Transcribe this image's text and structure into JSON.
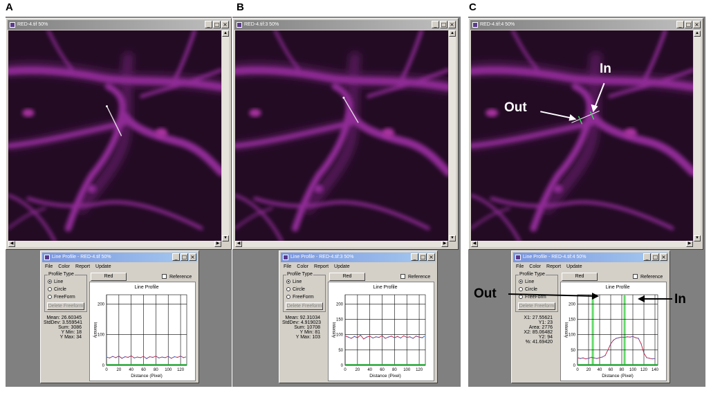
{
  "panels": [
    {
      "letter": "A",
      "image_title": "RED-4.tif 50%",
      "profile_title": "Line Profile - RED-4.tif 50%",
      "menu": [
        "File",
        "Color",
        "Report",
        "Update"
      ],
      "profile_type_label": "Profile Type",
      "options": [
        "Line",
        "Circle",
        "FreeForm"
      ],
      "selected_option": "Line",
      "delete_label": "Delete Freeform",
      "color_button": "Red",
      "reference_label": "Reference",
      "stats": [
        "Mean: 26.60345",
        "StdDev: 3.559541",
        "Sum: 3086",
        "Y Min: 18",
        "Y Max: 34"
      ]
    },
    {
      "letter": "B",
      "image_title": "RED-4.tif:3 50%",
      "profile_title": "Line Profile - RED-4.tif:3 50%",
      "menu": [
        "File",
        "Color",
        "Report",
        "Update"
      ],
      "profile_type_label": "Profile Type",
      "options": [
        "Line",
        "Circle",
        "FreeForm"
      ],
      "selected_option": "Line",
      "delete_label": "Delete Freeform",
      "color_button": "Red",
      "reference_label": "Reference",
      "stats": [
        "Mean: 92.31034",
        "StdDev: 4.919023",
        "Sum: 10708",
        "Y Min: 81",
        "Y Max: 103"
      ]
    },
    {
      "letter": "C",
      "image_title": "RED-4.tif:4 50%",
      "profile_title": "Line Profile - RED-4.tif:4 50%",
      "menu": [
        "File",
        "Color",
        "Report",
        "Update"
      ],
      "profile_type_label": "Profile Type",
      "options": [
        "Line",
        "Circle",
        "FreeForm"
      ],
      "selected_option": "Line",
      "delete_label": "Delete Freeform",
      "color_button": "Red",
      "reference_label": "Reference",
      "stats": [
        "X1: 27.55621",
        "Y1: 23",
        "Area: 2776",
        "X2: 85.06482",
        "Y2: 94",
        "%: 41.69420"
      ],
      "image_annotations": {
        "in": "In",
        "out": "Out"
      },
      "chart_annotations": {
        "in": "In",
        "out": "Out"
      }
    }
  ],
  "chart_data": [
    {
      "type": "line",
      "title": "Line Profile",
      "xlabel": "Distance (Pixel)",
      "ylabel": "Intensity",
      "xticks": [
        0,
        20,
        40,
        60,
        80,
        100,
        120
      ],
      "yticks": [
        0,
        100,
        200
      ],
      "xlim": [
        0,
        130
      ],
      "ylim": [
        0,
        230
      ],
      "series": [
        {
          "x": [
            0,
            5,
            10,
            15,
            20,
            25,
            30,
            35,
            40,
            45,
            50,
            55,
            60,
            65,
            70,
            75,
            80,
            85,
            90,
            95,
            100,
            105,
            110,
            115,
            120,
            125,
            128
          ],
          "y": [
            27,
            24,
            29,
            25,
            30,
            23,
            28,
            26,
            31,
            24,
            27,
            25,
            29,
            22,
            28,
            26,
            30,
            24,
            27,
            25,
            29,
            23,
            28,
            26,
            30,
            25,
            27
          ]
        }
      ]
    },
    {
      "type": "line",
      "title": "Line Profile",
      "xlabel": "Distance (Pixel)",
      "ylabel": "Intensity",
      "xticks": [
        0,
        20,
        40,
        60,
        80,
        100,
        120
      ],
      "yticks": [
        0,
        50,
        100,
        150,
        200
      ],
      "xlim": [
        0,
        130
      ],
      "ylim": [
        0,
        230
      ],
      "series": [
        {
          "x": [
            0,
            5,
            10,
            15,
            20,
            25,
            30,
            35,
            40,
            45,
            50,
            55,
            60,
            65,
            70,
            75,
            80,
            85,
            90,
            95,
            100,
            105,
            110,
            115,
            120,
            125,
            128
          ],
          "y": [
            96,
            92,
            88,
            94,
            90,
            98,
            86,
            92,
            95,
            89,
            93,
            91,
            97,
            88,
            92,
            95,
            90,
            94,
            89,
            96,
            91,
            93,
            88,
            95,
            92,
            90,
            94
          ]
        }
      ]
    },
    {
      "type": "line",
      "title": "Line Profile",
      "xlabel": "Distance (Pixel)",
      "ylabel": "Intensity",
      "xticks": [
        0,
        20,
        40,
        60,
        80,
        100,
        120,
        140
      ],
      "yticks": [
        0,
        50,
        100,
        150,
        200
      ],
      "xlim": [
        0,
        145
      ],
      "ylim": [
        0,
        230
      ],
      "markers": [
        27.55621,
        85.06482
      ],
      "series": [
        {
          "x": [
            0,
            5,
            10,
            15,
            20,
            25,
            30,
            35,
            40,
            45,
            50,
            55,
            60,
            65,
            70,
            75,
            80,
            85,
            90,
            95,
            100,
            105,
            110,
            115,
            120,
            125,
            130,
            135,
            140
          ],
          "y": [
            25,
            22,
            24,
            21,
            23,
            26,
            24,
            22,
            25,
            27,
            32,
            50,
            70,
            82,
            88,
            90,
            92,
            91,
            93,
            92,
            94,
            90,
            88,
            70,
            40,
            25,
            23,
            21,
            22
          ]
        }
      ]
    }
  ]
}
